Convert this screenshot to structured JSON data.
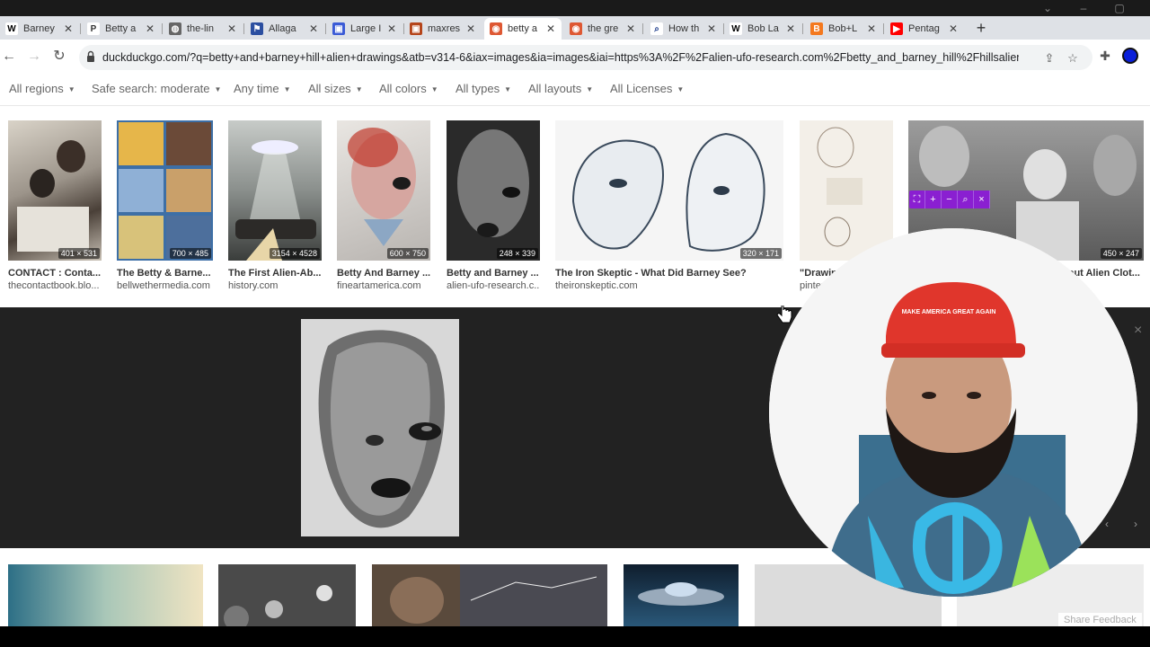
{
  "tabs": [
    {
      "title": "Barney",
      "favicon": "W",
      "color": "#ffffff",
      "fg": "#000000"
    },
    {
      "title": "Betty a",
      "favicon": "P",
      "color": "#ffffff",
      "fg": "#333333"
    },
    {
      "title": "the-lin",
      "favicon": "globe",
      "color": "#666666",
      "fg": "#ffffff"
    },
    {
      "title": "Allaga",
      "favicon": "flag",
      "color": "#2c4fa0",
      "fg": "#ffffff"
    },
    {
      "title": "Large I",
      "favicon": "img",
      "color": "#3b5bd6",
      "fg": "#ffffff"
    },
    {
      "title": "maxres",
      "favicon": "img",
      "color": "#b5451b",
      "fg": "#ffffff"
    },
    {
      "title": "betty a",
      "favicon": "ddg",
      "color": "#de5833",
      "fg": "#ffffff"
    },
    {
      "title": "the gre",
      "favicon": "ddg",
      "color": "#de5833",
      "fg": "#ffffff"
    },
    {
      "title": "How th",
      "favicon": "search",
      "color": "#ffffff",
      "fg": "#1a3a8a"
    },
    {
      "title": "Bob La",
      "favicon": "W",
      "color": "#ffffff",
      "fg": "#000000"
    },
    {
      "title": "Bob+L",
      "favicon": "B",
      "color": "#f4791f",
      "fg": "#ffffff"
    },
    {
      "title": "Pentag",
      "favicon": "yt",
      "color": "#ff0000",
      "fg": "#ffffff"
    }
  ],
  "address": {
    "url": "duckduckgo.com/?q=betty+and+barney+hill+alien+drawings&atb=v314-6&iax=images&ia=images&iai=https%3A%2F%2Falien-ufo-research.com%2Fbetty_and_barney_hill%2Fhillsalien.jpg"
  },
  "filters": [
    {
      "label": "All regions"
    },
    {
      "label": "Safe search: moderate"
    },
    {
      "label": "Any time"
    },
    {
      "label": "All sizes"
    },
    {
      "label": "All colors"
    },
    {
      "label": "All types"
    },
    {
      "label": "All layouts"
    },
    {
      "label": "All Licenses"
    }
  ],
  "results": [
    {
      "title": "CONTACT : Conta...",
      "source": "thecontactbook.blo...",
      "dims": "401 × 531"
    },
    {
      "title": "The Betty & Barne...",
      "source": "bellwethermedia.com",
      "dims": "700 × 485"
    },
    {
      "title": "The First Alien-Ab...",
      "source": "history.com",
      "dims": "3154 × 4528"
    },
    {
      "title": "Betty And Barney ...",
      "source": "fineartamerica.com",
      "dims": "600 × 750"
    },
    {
      "title": "Betty and Barney ...",
      "source": "alien-ufo-research.c...",
      "dims": "248 × 339"
    },
    {
      "title": "The Iron Skeptic - What Did Barney See?",
      "source": "theironskeptic.com",
      "dims": "320 × 171"
    },
    {
      "title": "\"Drawin",
      "source": "pinter",
      "dims": ""
    },
    {
      "title": "bout Alien Clot...",
      "source": "",
      "dims": "450 × 247"
    }
  ],
  "preview": {
    "close": "×",
    "prev": "‹",
    "next": "›"
  },
  "share_feedback": "Share Feedback",
  "cap_text": "MAKE AMERICA GREAT AGAIN"
}
